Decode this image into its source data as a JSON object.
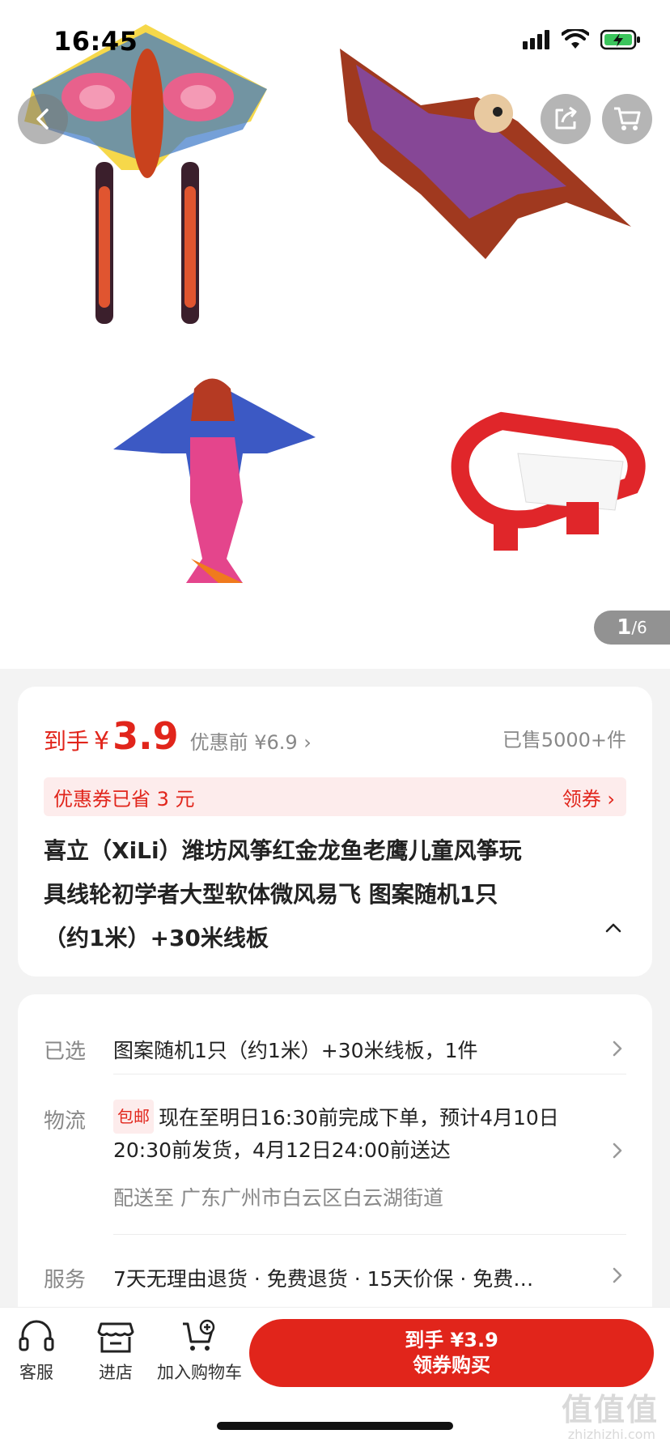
{
  "status_bar": {
    "time": "16:45"
  },
  "gallery": {
    "current_page": "1",
    "total_pages": "/6"
  },
  "price": {
    "daoshou_label": "到手",
    "currency": "¥",
    "value": "3.9",
    "before_label": "优惠前 ¥6.9 ›",
    "sold": "已售5000+件"
  },
  "coupon": {
    "text": "优惠券已省 3 元",
    "action": "领券 ›"
  },
  "product": {
    "title_lines": [
      "喜立（XiLi）潍坊风筝红金龙鱼老鹰儿童风筝玩",
      "具线轮初学者大型软体微风易飞 图案随机1只",
      "（约1米）+30米线板"
    ]
  },
  "details": {
    "selected_label": "已选",
    "selected_value": "图案随机1只（约1米）+30米线板，1件",
    "shipping_label": "物流",
    "shipping_tag": "包邮",
    "shipping_text": "现在至明日16:30前完成下单，预计4月10日20:30前发货，4月12日24:00前送达",
    "deliver_to": "配送至  广东广州市白云区白云湖街道",
    "service_label": "服务",
    "service_value": "7天无理由退货 · 免费退货 · 15天价保 · 免费…"
  },
  "bottom_bar": {
    "service": "客服",
    "store": "进店",
    "add_cart": "加入购物车",
    "buy_line1": "到手 ¥3.9",
    "buy_line2": "领券购买"
  },
  "watermark": {
    "main": "值值值",
    "sub": "zhizhizhi.com"
  },
  "colors": {
    "accent": "#e1251b",
    "coupon_bg": "#fdecec",
    "page_bg": "#f3f3f3"
  }
}
